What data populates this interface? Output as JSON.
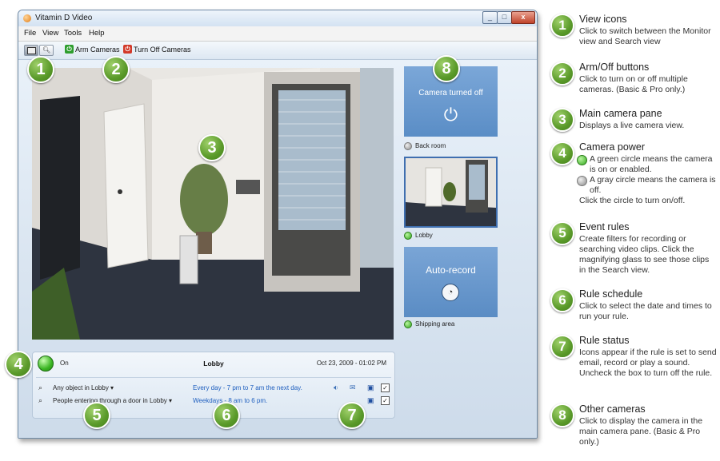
{
  "window": {
    "title": "Vitamin D Video",
    "min": "_",
    "max": "□",
    "close": "x"
  },
  "menu": {
    "items": [
      "File",
      "View",
      "Tools",
      "Help"
    ]
  },
  "toolbar": {
    "arm": "Arm Cameras",
    "turn_off": "Turn Off Cameras"
  },
  "cameras": {
    "back_room": {
      "status_text": "Camera turned off",
      "label": "Back room"
    },
    "lobby": {
      "label": "Lobby"
    },
    "shipping": {
      "status_text": "Auto-record",
      "label": "Shipping area"
    }
  },
  "rules_panel": {
    "state": "On",
    "camera": "Lobby",
    "date": "Oct 23, 2009 - 01:02 PM",
    "rules": [
      {
        "name": "Any object in Lobby",
        "schedule": "Every day - 7 pm to 7 am the next day."
      },
      {
        "name": "People entering through a door in Lobby",
        "schedule": "Weekdays - 8 am to 6 pm."
      }
    ]
  },
  "badges": [
    "1",
    "2",
    "3",
    "4",
    "5",
    "6",
    "7",
    "8"
  ],
  "legend": [
    {
      "num": "1",
      "title": "View icons",
      "body": "Click to switch between the Monitor view and Search view"
    },
    {
      "num": "2",
      "title": "Arm/Off buttons",
      "body": "Click to turn on or off multiple cameras. (Basic & Pro only.)"
    },
    {
      "num": "3",
      "title": "Main camera pane",
      "body": "Displays a live camera view."
    },
    {
      "num": "4",
      "title": "Camera power",
      "green": "A green circle means the camera is on or enabled.",
      "gray": "A gray circle means the camera is off.",
      "body": "Click the circle to turn on/off."
    },
    {
      "num": "5",
      "title": "Event rules",
      "body": "Create filters for recording or searching video clips. Click the magnifying glass to see those clips in the Search view."
    },
    {
      "num": "6",
      "title": "Rule schedule",
      "body": "Click to select the date and times to run your rule."
    },
    {
      "num": "7",
      "title": "Rule status",
      "body": "Icons appear if the rule is set to send email, record or play a sound.  Uncheck the box to turn off the rule."
    },
    {
      "num": "8",
      "title": "Other cameras",
      "body": "Click to display the camera in the main camera pane. (Basic & Pro only.)"
    }
  ]
}
